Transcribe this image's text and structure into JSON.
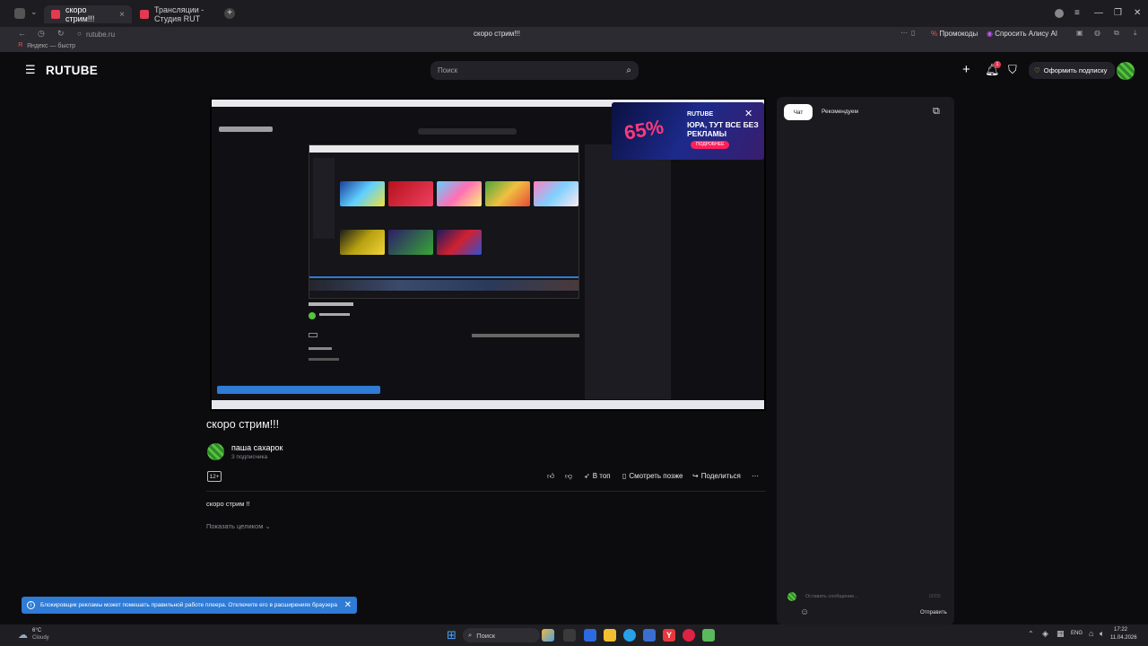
{
  "browser": {
    "tabs": [
      {
        "label": "скоро стрим!!!",
        "active": true
      },
      {
        "label": "Трансляции - Студия RUT",
        "active": false
      }
    ],
    "url": "rutube.ru",
    "page_title": "скоро стрим!!!",
    "promo": "Промокоды",
    "alice": "Спросить Алису AI",
    "bookmark": "Яндекс — быстр"
  },
  "site": {
    "logo": "RUTUBE",
    "search_placeholder": "Поиск",
    "subscribe_label": "Оформить подписку",
    "notification_count": "1"
  },
  "video": {
    "title": "скоро стрим!!!",
    "ad": {
      "percent": "65%",
      "brand": "RUTUBE",
      "text": "ЮРА, ТУТ ВСЕ БЕЗ РЕКЛАМЫ",
      "cta": "ПОДРОБНЕЕ"
    }
  },
  "channel": {
    "name": "паша сахарок",
    "subscribers": "3 подписчика"
  },
  "actions": {
    "age": "12+",
    "top": "В топ",
    "watch_later": "Смотреть позже",
    "share": "Поделиться"
  },
  "description": {
    "text": "скоро стрим !!",
    "show_more": "Показать целиком"
  },
  "chat": {
    "tab_chat": "Чат",
    "tab_recommend": "Рекомендуем",
    "input_placeholder": "Оставить сообщение...",
    "counter": "0/200",
    "send": "Отправить"
  },
  "toast": {
    "text": "Блокировщик рекламы может помешать правильной работе плеера. Отключите его в расширениях браузера"
  },
  "taskbar": {
    "weather_temp": "6°C",
    "weather_desc": "Cloudy",
    "search": "Поиск",
    "lang": "ENG",
    "time": "17:22",
    "date": "11.04.2026"
  },
  "colors": {
    "accent_blue": "#2f7bd6",
    "brand_red": "#e53950",
    "bg": "#0c0c0f"
  }
}
